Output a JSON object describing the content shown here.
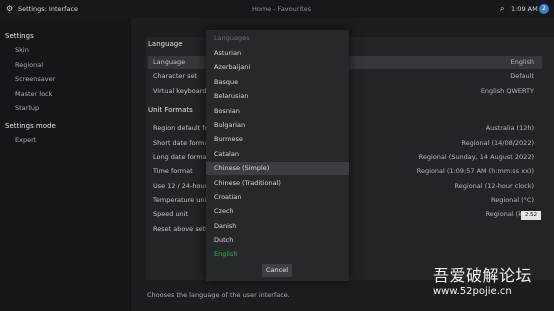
{
  "topbar": {
    "title": "Settings: Interface",
    "breadcrumb": "Home - Favourites",
    "time": "1:09 AM",
    "avatar_letter": "2",
    "menu_icon": "gear-icon",
    "search_icon": "search-icon"
  },
  "sidebar": {
    "heading": "Settings",
    "items": [
      "Skin",
      "Regional",
      "Screensaver",
      "Master lock",
      "Startup"
    ],
    "mode_heading": "Settings mode",
    "mode_item": "Expert"
  },
  "main": {
    "sections": [
      {
        "title": "Language",
        "rows": [
          {
            "label": "Language",
            "value": "English"
          },
          {
            "label": "Character set",
            "value": "Default"
          },
          {
            "label": "Virtual keyboard",
            "value": "English QWERTY"
          }
        ]
      },
      {
        "title": "Unit Formats",
        "rows": [
          {
            "label": "Region default fo",
            "value": "Australia (12h)"
          },
          {
            "label": "Short date forma",
            "value": "Regional (14/08/2022)"
          },
          {
            "label": "Long date forma",
            "value": "Regional (Sunday, 14 August 2022)"
          },
          {
            "label": "Time format",
            "value": "Regional (1:09:57 AM (h:mm:ss xx))"
          },
          {
            "label": "Use 12 / 24-hour",
            "value": "Regional (12-hour clock)"
          },
          {
            "label": "Temperature uni",
            "value": "Regional (°C)"
          },
          {
            "label": "Speed unit",
            "value": "Regional (k"
          },
          {
            "label": "Reset above setti",
            "value": ""
          }
        ]
      }
    ],
    "badge": "2.52",
    "footer": "Chooses the language of the user interface."
  },
  "dialog": {
    "title": "Languages",
    "items": [
      "Asturian",
      "Azerbaijani",
      "Basque",
      "Belarusian",
      "Bosnian",
      "Bulgarian",
      "Burmese",
      "Catalan",
      "Chinese (Simple)",
      "Chinese (Traditional)",
      "Croatian",
      "Czech",
      "Danish",
      "Dutch",
      "English"
    ],
    "focused": "Chinese (Simple)",
    "current": "English",
    "cancel_label": "Cancel",
    "current_color": "#32b44a"
  },
  "watermark": {
    "line1": "吾爱破解论坛",
    "line2": "www.52pojie.cn"
  }
}
